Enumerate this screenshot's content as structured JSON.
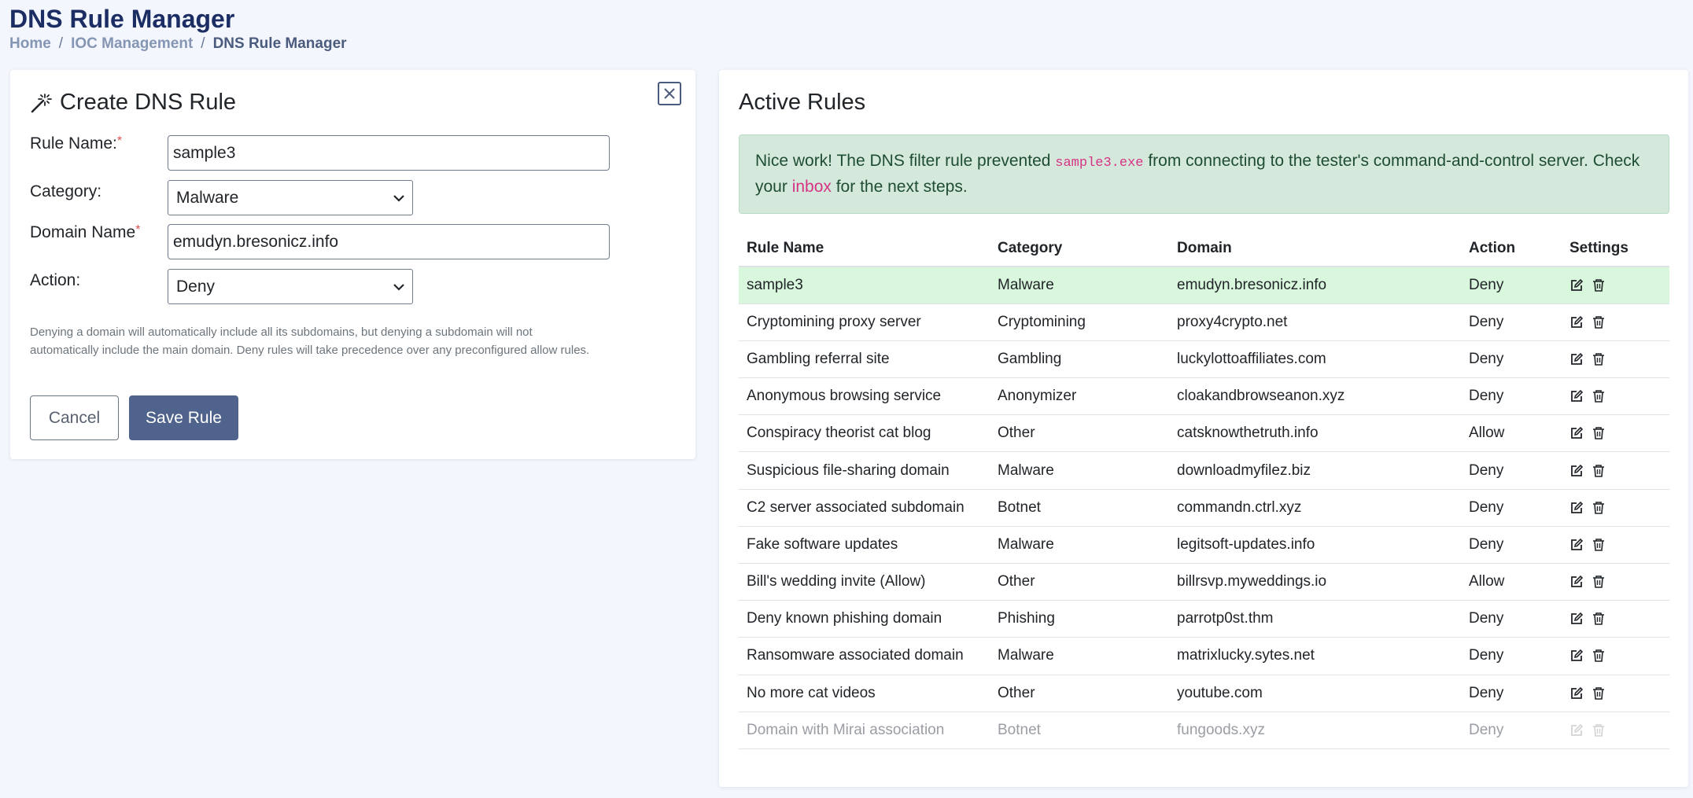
{
  "header": {
    "title": "DNS Rule Manager",
    "breadcrumb": [
      "Home",
      "IOC Management",
      "DNS Rule Manager"
    ]
  },
  "form": {
    "title": "Create DNS Rule",
    "rule_name_label": "Rule Name:",
    "rule_name_value": "sample3",
    "category_label": "Category:",
    "category_value": "Malware",
    "domain_label": "Domain Name",
    "domain_value": "emudyn.bresonicz.info",
    "action_label": "Action:",
    "action_value": "Deny",
    "required_mark": "*",
    "help_text": "Denying a domain will automatically include all its subdomains, but denying a subdomain will not automatically include the main domain. Deny rules will take precedence over any preconfigured allow rules.",
    "cancel_label": "Cancel",
    "save_label": "Save Rule"
  },
  "rules_panel": {
    "title": "Active Rules",
    "alert": {
      "text_before": "Nice work! The DNS filter rule prevented ",
      "code": "sample3.exe",
      "text_middle": " from connecting to the tester's command-and-control server. Check your ",
      "link": "inbox",
      "text_after": " for the next steps."
    },
    "columns": [
      "Rule Name",
      "Category",
      "Domain",
      "Action",
      "Settings"
    ],
    "rows": [
      {
        "name": "sample3",
        "category": "Malware",
        "domain": "emudyn.bresonicz.info",
        "action": "Deny"
      },
      {
        "name": "Cryptomining proxy server",
        "category": "Cryptomining",
        "domain": "proxy4crypto.net",
        "action": "Deny"
      },
      {
        "name": "Gambling referral site",
        "category": "Gambling",
        "domain": "luckylottoaffiliates.com",
        "action": "Deny"
      },
      {
        "name": "Anonymous browsing service",
        "category": "Anonymizer",
        "domain": "cloakandbrowseanon.xyz",
        "action": "Deny"
      },
      {
        "name": "Conspiracy theorist cat blog",
        "category": "Other",
        "domain": "catsknowthetruth.info",
        "action": "Allow"
      },
      {
        "name": "Suspicious file-sharing domain",
        "category": "Malware",
        "domain": "downloadmyfilez.biz",
        "action": "Deny"
      },
      {
        "name": "C2 server associated subdomain",
        "category": "Botnet",
        "domain": "commandn.ctrl.xyz",
        "action": "Deny"
      },
      {
        "name": "Fake software updates",
        "category": "Malware",
        "domain": "legitsoft-updates.info",
        "action": "Deny"
      },
      {
        "name": "Bill's wedding invite (Allow)",
        "category": "Other",
        "domain": "billrsvp.myweddings.io",
        "action": "Allow"
      },
      {
        "name": "Deny known phishing domain",
        "category": "Phishing",
        "domain": "parrotp0st.thm",
        "action": "Deny"
      },
      {
        "name": "Ransomware associated domain",
        "category": "Malware",
        "domain": "matrixlucky.sytes.net",
        "action": "Deny"
      },
      {
        "name": "No more cat videos",
        "category": "Other",
        "domain": "youtube.com",
        "action": "Deny"
      },
      {
        "name": "Domain with Mirai association",
        "category": "Botnet",
        "domain": "fungoods.xyz",
        "action": "Deny"
      }
    ]
  }
}
